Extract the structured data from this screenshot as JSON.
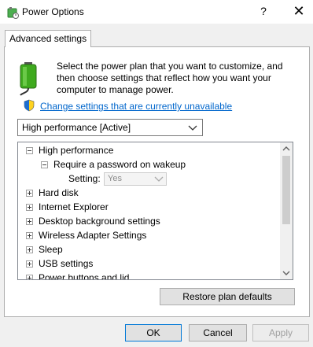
{
  "window": {
    "title": "Power Options",
    "help_label": "?",
    "close_label": "✕"
  },
  "tabs": [
    {
      "label": "Advanced settings"
    }
  ],
  "description": "Select the power plan that you want to customize, and then choose settings that reflect how you want your computer to manage power.",
  "change_link": "Change settings that are currently unavailable",
  "plan_select": {
    "value": "High performance [Active]"
  },
  "tree": {
    "plan": "High performance",
    "items": [
      "Require a password on wakeup",
      "Hard disk",
      "Internet Explorer",
      "Desktop background settings",
      "Wireless Adapter Settings",
      "Sleep",
      "USB settings",
      "Power buttons and lid"
    ],
    "setting": {
      "label": "Setting:",
      "value": "Yes"
    }
  },
  "buttons": {
    "restore": "Restore plan defaults",
    "ok": "OK",
    "cancel": "Cancel",
    "apply": "Apply"
  },
  "colors": {
    "link": "#0066cc",
    "scrollbar_thumb": "#cdcdcd",
    "battery": "#3faa1e"
  },
  "icons": [
    "power-options-icon",
    "battery-plug-icon",
    "uac-shield-icon",
    "chevron-down-icon",
    "scroll-up-arrow-icon",
    "scroll-down-arrow-icon"
  ]
}
